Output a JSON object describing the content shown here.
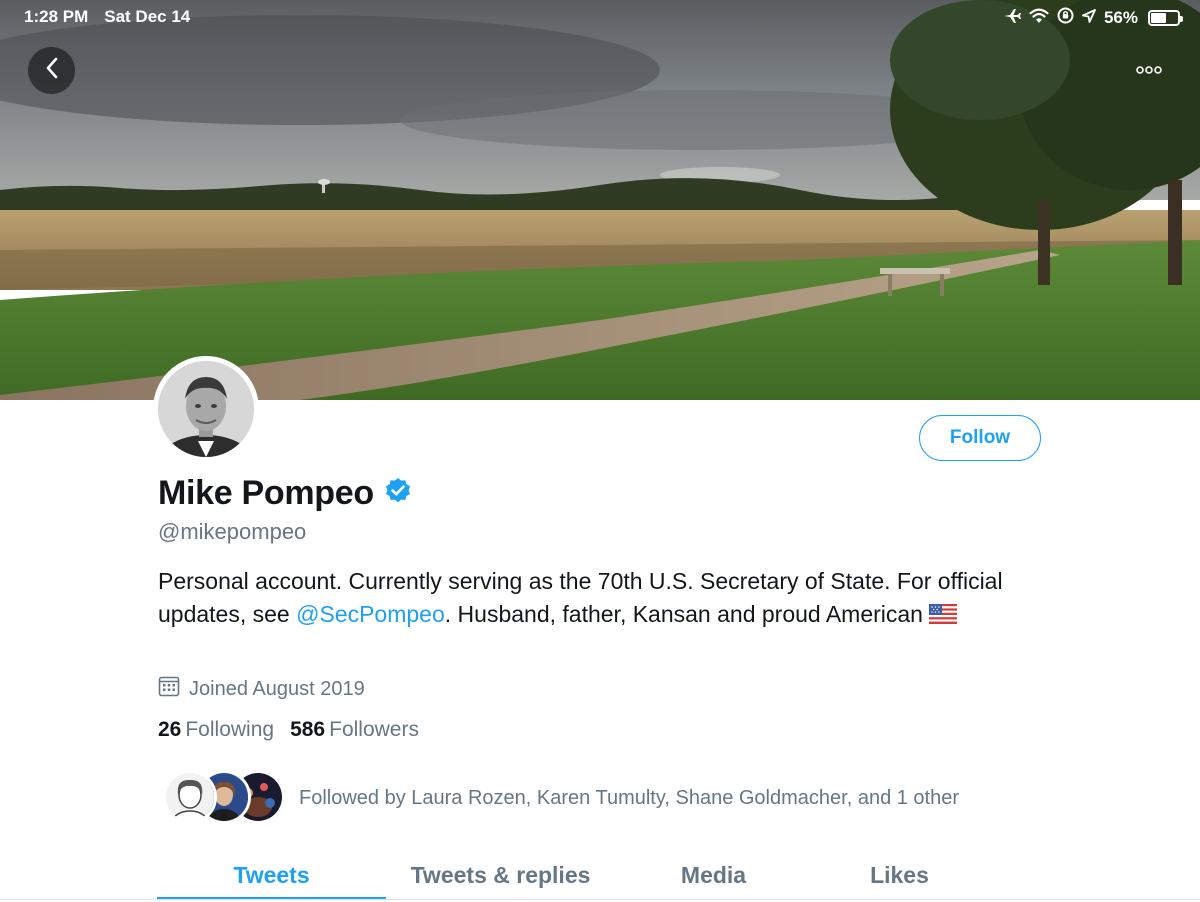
{
  "status_bar": {
    "time": "1:28 PM",
    "date": "Sat Dec 14",
    "battery": "56%",
    "battery_level": 0.56,
    "icons": [
      "airplane-icon",
      "wifi-icon",
      "orientation-lock-icon",
      "location-icon",
      "battery-icon"
    ]
  },
  "nav": {
    "back_icon": "chevron-left-icon",
    "more_icon": "more-dots-icon"
  },
  "profile": {
    "display_name": "Mike Pompeo",
    "verified": true,
    "handle": "@mikepompeo",
    "bio_part1": "Personal account. Currently serving as the 70th U.S. Secretary of State. For official updates, see ",
    "bio_mention": "@SecPompeo",
    "bio_part2": ". Husband, father, Kansan and proud American",
    "joined": "Joined August 2019",
    "following_count": "26",
    "following_label": "Following",
    "followers_count": "586",
    "followers_label": "Followers",
    "followed_by": "Followed by Laura Rozen, Karen Tumulty, Shane Goldmacher, and 1 other",
    "follow_label": "Follow"
  },
  "tabs": [
    {
      "label": "Tweets",
      "active": true
    },
    {
      "label": "Tweets & replies",
      "active": false
    },
    {
      "label": "Media",
      "active": false
    },
    {
      "label": "Likes",
      "active": false
    }
  ],
  "colors": {
    "accent": "#1da1f2",
    "secondary_text": "#657786",
    "primary_text": "#14171a",
    "verified": "#1da1f2"
  }
}
